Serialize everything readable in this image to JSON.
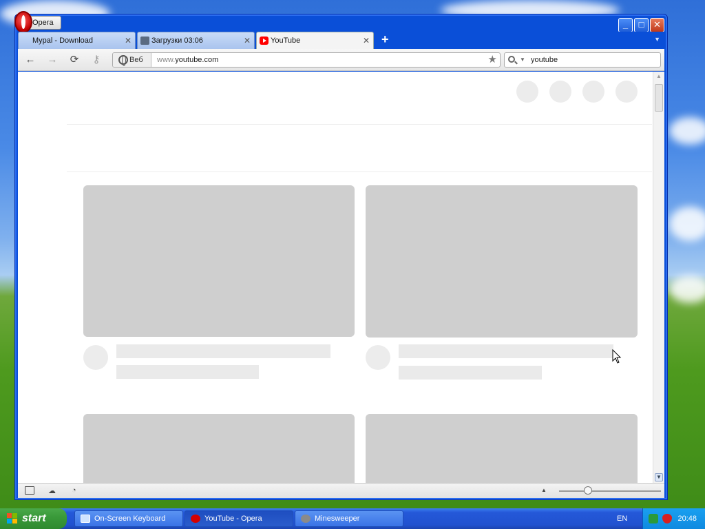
{
  "window": {
    "menu_label": "Opera",
    "controls": {
      "minimize": "_",
      "maximize": "□",
      "close": "✕"
    }
  },
  "tabs": [
    {
      "label": "Mypal - Download",
      "favicon": "download-page-icon",
      "active": false
    },
    {
      "label": "Загрузки 03:06",
      "favicon": "downloads-icon",
      "active": false
    },
    {
      "label": "YouTube",
      "favicon": "youtube-icon",
      "active": true
    }
  ],
  "toolbar": {
    "back": "←",
    "forward": "→",
    "reload": "⟳",
    "key": "⚷",
    "address_badge": "Веб",
    "address_prefix": "www.",
    "address_host": "youtube.com",
    "star": "★",
    "search_value": "youtube"
  },
  "content": {
    "scroll_down": "▼",
    "scroll_up": "▲"
  },
  "statusbar": {
    "panel_icon": "panel-icon",
    "unite_icon": "cloud-icon",
    "turbo_icon": "speedometer-icon",
    "zoom_up": "▲"
  },
  "taskbar": {
    "start_label": "start",
    "tasks": [
      {
        "label": "On-Screen Keyboard",
        "icon": "keyboard-icon",
        "active": false
      },
      {
        "label": "YouTube - Opera",
        "icon": "opera-icon",
        "active": true
      },
      {
        "label": "Minesweeper",
        "icon": "minesweeper-icon",
        "active": false
      }
    ],
    "language": "EN",
    "clock": "20:48"
  },
  "colors": {
    "xp_blue": "#0a4fd8",
    "youtube_red": "#ff0000",
    "skeleton": "#cfcfcf",
    "start_green": "#3a9a3a"
  }
}
